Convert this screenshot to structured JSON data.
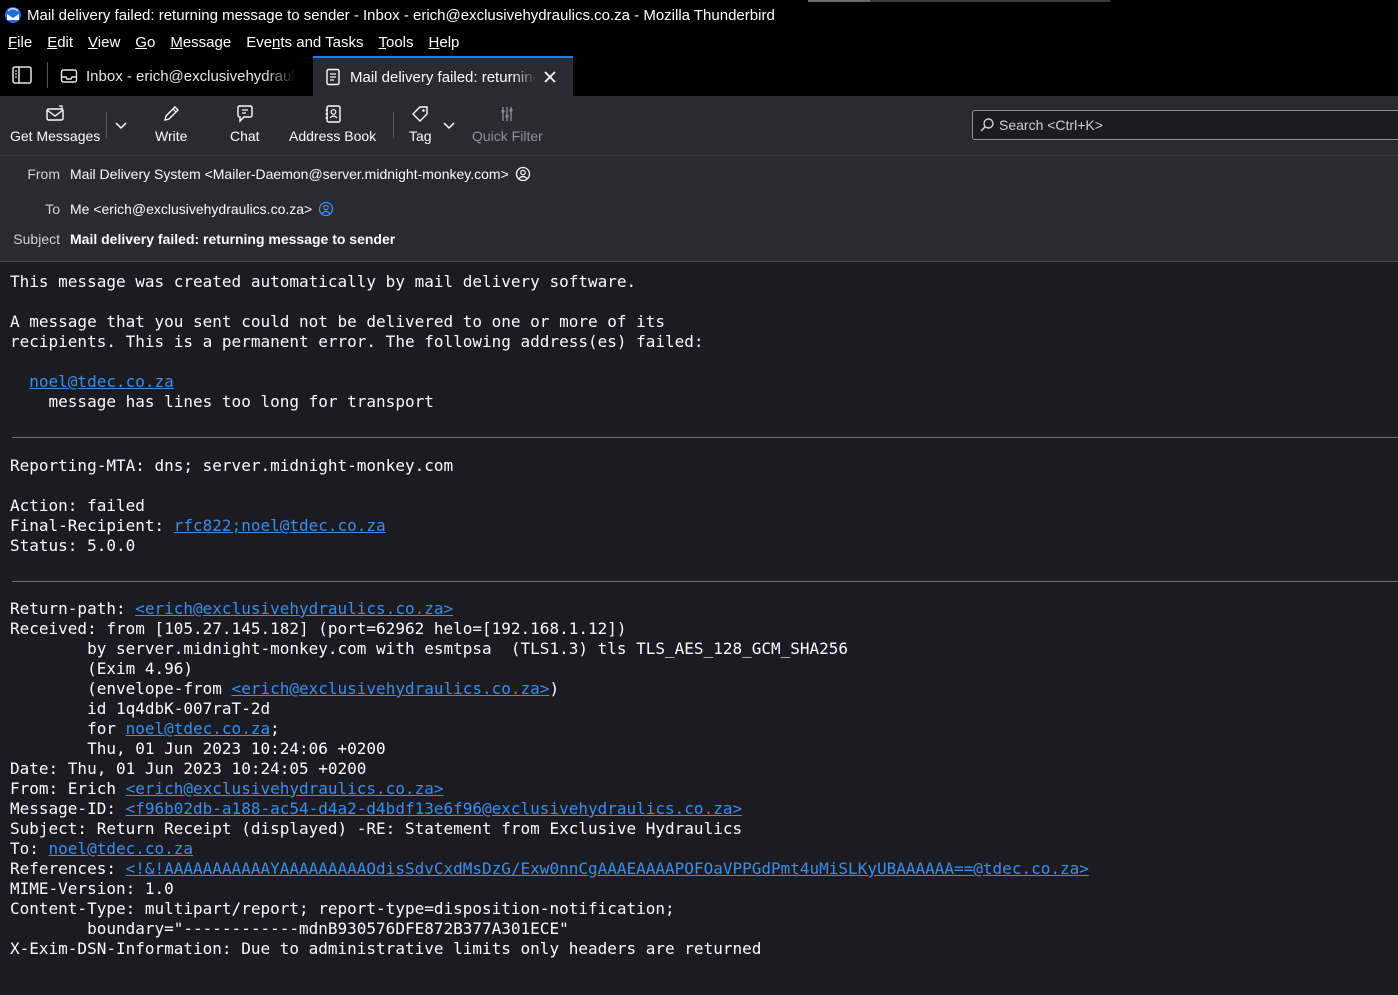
{
  "window": {
    "title": "Mail delivery failed: returning message to sender - Inbox - erich@exclusivehydraulics.co.za - Mozilla Thunderbird"
  },
  "menubar": {
    "items": [
      "File",
      "Edit",
      "View",
      "Go",
      "Message",
      "Events and Tasks",
      "Tools",
      "Help"
    ]
  },
  "tabs": [
    {
      "label": "Inbox - erich@exclusivehydraulics.co.za",
      "icon": "inbox-icon"
    },
    {
      "label": "Mail delivery failed: returning message to sender",
      "icon": "message-icon",
      "active": true
    }
  ],
  "toolbar": {
    "get_messages": "Get Messages",
    "write": "Write",
    "chat": "Chat",
    "address_book": "Address Book",
    "tag": "Tag",
    "quick_filter": "Quick Filter",
    "search_placeholder": "Search <Ctrl+K>"
  },
  "header": {
    "from_label": "From",
    "from_value": "Mail Delivery System <Mailer-Daemon@server.midnight-monkey.com>",
    "to_label": "To",
    "to_value": "Me <erich@exclusivehydraulics.co.za>",
    "subject_label": "Subject",
    "subject_value": "Mail delivery failed: returning message to sender"
  },
  "body": {
    "intro1": "This message was created automatically by mail delivery software.",
    "intro2": "A message that you sent could not be delivered to one or more of its",
    "intro3": "recipients. This is a permanent error. The following address(es) failed:",
    "failed_address": "noel@tdec.co.za",
    "failed_reason": "message has lines too long for transport",
    "reporting_mta": "Reporting-MTA: dns; server.midnight-monkey.com",
    "action": "Action: failed",
    "final_recipient_label": "Final-Recipient: ",
    "final_recipient_link": "rfc822;noel@tdec.co.za",
    "status": "Status: 5.0.0",
    "return_path_label": "Return-path: ",
    "return_path_link": "<erich@exclusivehydraulics.co.za>",
    "received1": "Received: from [105.27.145.182] (port=62962 helo=[192.168.1.12])",
    "received2": "        by server.midnight-monkey.com with esmtpsa  (TLS1.3) tls TLS_AES_128_GCM_SHA256",
    "received3": "        (Exim 4.96)",
    "received4_pre": "        (envelope-from ",
    "received4_link": "<erich@exclusivehydraulics.co.za>",
    "received4_post": ")",
    "received5": "        id 1q4dbK-007raT-2d",
    "received6_pre": "        for ",
    "received6_link": "noel@tdec.co.za",
    "received6_post": ";",
    "received7": "        Thu, 01 Jun 2023 10:24:06 +0200",
    "date": "Date: Thu, 01 Jun 2023 10:24:05 +0200",
    "from_pre": "From: Erich ",
    "from_link": "<erich@exclusivehydraulics.co.za>",
    "msgid_pre": "Message-ID: ",
    "msgid_link": "<f96b02db-a188-ac54-d4a2-d4bdf13e6f96@exclusivehydraulics.co.za>",
    "subject": "Subject: Return Receipt (displayed) -RE: Statement from Exclusive Hydraulics",
    "to_pre": "To: ",
    "to_link": "noel@tdec.co.za",
    "references_pre": "References: ",
    "references_link": "<!&!AAAAAAAAAAAYAAAAAAAAAOdisSdvCxdMsDzG/Exw0nnCgAAAEAAAAPOFOaVPPGdPmt4uMiSLKyUBAAAAAA==@tdec.co.za>",
    "mime": "MIME-Version: 1.0",
    "content_type": "Content-Type: multipart/report; report-type=disposition-notification;",
    "boundary": "        boundary=\"------------mdnB930576DFE872B377A301ECE\"",
    "xexim": "X-Exim-DSN-Information: Due to administrative limits only headers are returned"
  },
  "colors": {
    "accent": "#0a84ff",
    "link": "#3b8eea",
    "background": "#1c1b22",
    "toolbar": "#2b2a33"
  }
}
